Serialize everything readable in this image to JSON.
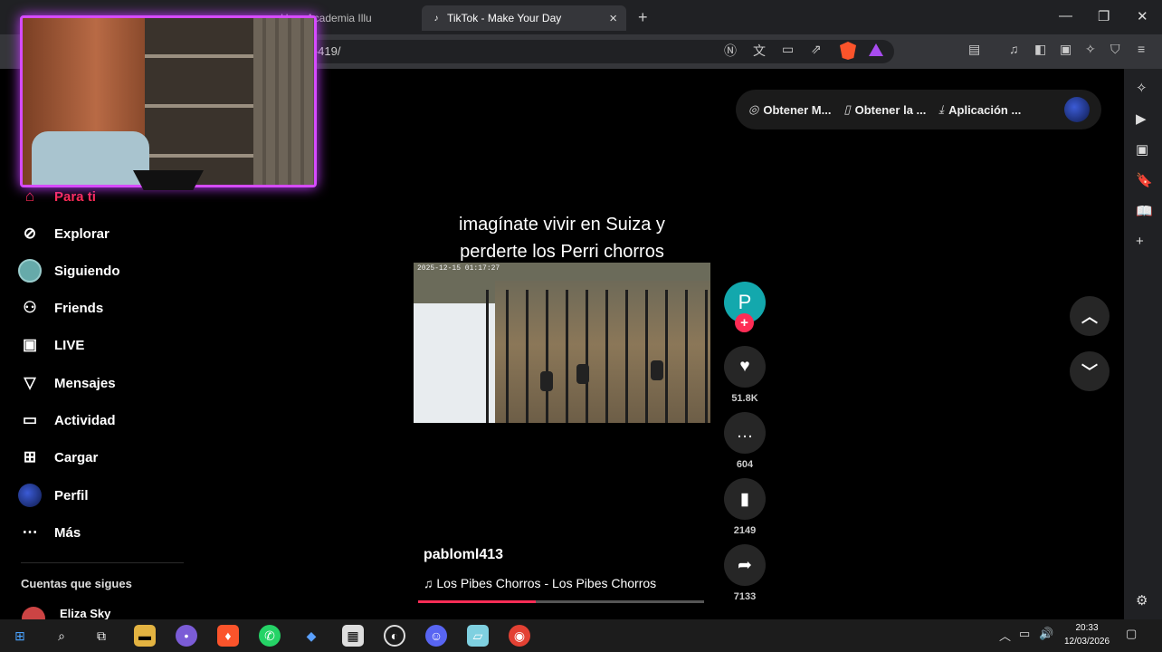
{
  "browser": {
    "tabs": [
      {
        "label": "Hero Academia Illu",
        "active": false
      },
      {
        "label": "TikTok - Make Your Day",
        "active": true
      }
    ],
    "new_tab": "+",
    "url": "...-419/"
  },
  "header": {
    "buttons": [
      {
        "label": "Obtener M...",
        "icon": "coin-icon"
      },
      {
        "label": "Obtener la ...",
        "icon": "phone-icon"
      },
      {
        "label": "Aplicación ...",
        "icon": "download-icon"
      }
    ]
  },
  "sidebar": {
    "items": [
      {
        "label": "Para ti",
        "icon": "home-icon",
        "active": true
      },
      {
        "label": "Explorar",
        "icon": "compass-icon"
      },
      {
        "label": "Siguiendo",
        "icon": "avatar-icon"
      },
      {
        "label": "Friends",
        "icon": "friends-icon"
      },
      {
        "label": "LIVE",
        "icon": "live-icon"
      },
      {
        "label": "Mensajes",
        "icon": "send-icon"
      },
      {
        "label": "Actividad",
        "icon": "activity-icon"
      },
      {
        "label": "Cargar",
        "icon": "plus-square-icon"
      },
      {
        "label": "Perfil",
        "icon": "profile-icon"
      },
      {
        "label": "Más",
        "icon": "more-icon"
      }
    ],
    "following_header": "Cuentas que sigues",
    "following": [
      {
        "name": "Eliza Sky"
      }
    ]
  },
  "video": {
    "caption_line1": "imagínate vivir en Suiza y",
    "caption_line2": "perderte los Perri chorros",
    "timestamp": "2025-12-15 01:17:27",
    "author": "pabloml413",
    "avatar_letter": "P",
    "follow_plus": "+",
    "music": "Los Pibes Chorros - Los Pibes Chorros",
    "progress": 0.41,
    "likes": "51.8K",
    "comments": "604",
    "saves": "2149",
    "shares": "7133"
  },
  "taskbar": {
    "time": "20:33",
    "date": "12/03/2026"
  },
  "colors": {
    "accent": "#fe2c55",
    "webcam_glow": "#d64bff",
    "avatar": "#13a8ad"
  }
}
